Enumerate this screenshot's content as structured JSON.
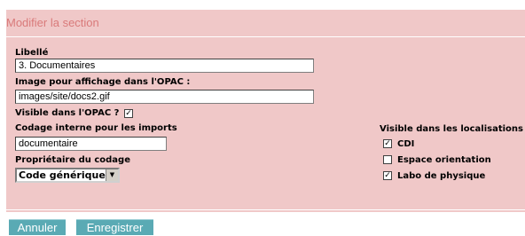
{
  "section_title": "Modifier la section",
  "libelle": {
    "label": "Libellé",
    "value": "3. Documentaires"
  },
  "image_opac": {
    "label": "Image pour affichage dans l'OPAC :",
    "value": "images/site/docs2.gif"
  },
  "visible_opac": {
    "label": "Visible dans l'OPAC ?",
    "checked": true,
    "mark": "✓"
  },
  "codage": {
    "label": "Codage interne pour les imports",
    "value": "documentaire"
  },
  "proprietaire": {
    "label": "Propriétaire du codage",
    "selected": "Code générique",
    "arrow": "▼"
  },
  "localisations": {
    "label": "Visible dans les localisations :",
    "items": [
      {
        "label": "CDI",
        "checked": true,
        "mark": "✓"
      },
      {
        "label": "Espace orientation",
        "checked": false,
        "mark": ""
      },
      {
        "label": "Labo de physique",
        "checked": true,
        "mark": "✓"
      }
    ]
  },
  "buttons": {
    "cancel": "Annuler",
    "save": "Enregistrer"
  },
  "colors": {
    "panel_bg": "#f0c8c8",
    "title": "#d97a7a",
    "button_bg": "#5aaab4"
  }
}
